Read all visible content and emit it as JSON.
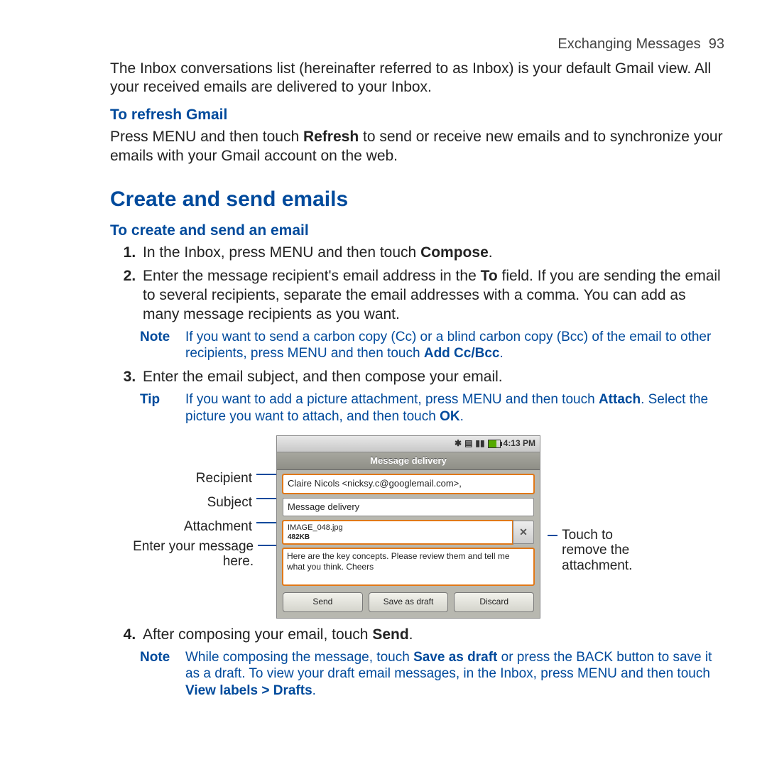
{
  "header": {
    "section": "Exchanging Messages",
    "page": "93"
  },
  "intro": "The Inbox conversations list (hereinafter referred to as Inbox) is your default Gmail view. All your received emails are delivered to your Inbox.",
  "refresh": {
    "heading": "To refresh Gmail",
    "body_pre": "Press MENU and then touch ",
    "body_bold": "Refresh",
    "body_post": " to send or receive new emails and to synchronize your emails with your Gmail account on the web."
  },
  "section_title": "Create and send emails",
  "create": {
    "heading": "To create and send an email",
    "steps": {
      "s1_pre": "In the Inbox, press MENU and then touch ",
      "s1_bold": "Compose",
      "s1_post": ".",
      "s2_pre": "Enter the message recipient's email address in the ",
      "s2_bold": "To",
      "s2_post": " field. If you are sending the email to several recipients, separate the email addresses with a comma. You can add as many message recipients as you want.",
      "s3": "Enter the email subject, and then compose your email.",
      "s4_pre": "After composing your email, touch ",
      "s4_bold": "Send",
      "s4_post": "."
    },
    "note1_label": "Note",
    "note1_pre": "If you want to send a carbon copy (Cc) or a blind carbon copy (Bcc) of the email to other recipients, press MENU and then touch ",
    "note1_bold": "Add Cc/Bcc",
    "note1_post": ".",
    "tip_label": "Tip",
    "tip_pre": "If you want to add a picture attachment, press MENU and then touch ",
    "tip_bold1": "Attach",
    "tip_mid": ". Select the picture you want to attach, and then touch ",
    "tip_bold2": "OK",
    "tip_post": ".",
    "note2_label": "Note",
    "note2_pre": "While composing the message, touch ",
    "note2_bold1": "Save as draft",
    "note2_mid1": " or press the BACK button to save it as a draft. To view your draft email messages, in the Inbox, press MENU and then touch ",
    "note2_bold2": "View labels > Drafts",
    "note2_post": "."
  },
  "mock": {
    "statusbar_time": "4:13 PM",
    "title": "Message delivery",
    "to": "Claire Nicols <nicksy.c@googlemail.com>,",
    "subject": "Message delivery",
    "attach_name": "IMAGE_048.jpg",
    "attach_size": "482KB",
    "body": "Here are the key concepts. Please review them and tell me what you think. Cheers",
    "btn_send": "Send",
    "btn_draft": "Save as draft",
    "btn_discard": "Discard"
  },
  "callouts": {
    "recipient": "Recipient",
    "subject": "Subject",
    "attachment": "Attachment",
    "message": "Enter your message here.",
    "remove": "Touch to remove the attachment."
  }
}
